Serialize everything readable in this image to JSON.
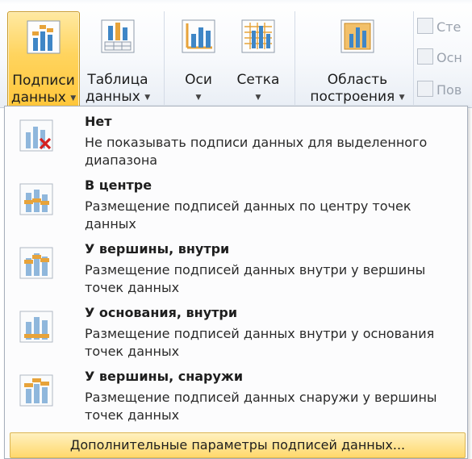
{
  "ribbon": {
    "buttons": [
      {
        "line1": "Подписи",
        "line2": "данных"
      },
      {
        "line1": "Таблица",
        "line2": "данных"
      },
      {
        "line1": "Оси",
        "line2": ""
      },
      {
        "line1": "Сетка",
        "line2": ""
      },
      {
        "line1": "Область",
        "line2": "построения"
      }
    ],
    "small_items": [
      "Сте",
      "Осн",
      "Пов"
    ]
  },
  "menu": {
    "items": [
      {
        "title": "Нет",
        "desc": "Не показывать подписи данных для выделенного диапазона",
        "icon": "no-labels-icon"
      },
      {
        "title": "В центре",
        "desc": "Размещение подписей данных по центру точек данных",
        "icon": "labels-center-icon"
      },
      {
        "title": "У вершины, внутри",
        "desc": "Размещение подписей данных внутри у вершины точек данных",
        "icon": "labels-inside-end-icon"
      },
      {
        "title": "У основания, внутри",
        "desc": "Размещение подписей данных внутри у основания точек данных",
        "icon": "labels-inside-base-icon"
      },
      {
        "title": "У вершины, снаружи",
        "desc": "Размещение подписей данных снаружи у вершины точек данных",
        "icon": "labels-outside-end-icon"
      }
    ],
    "footer": "Дополнительные параметры подписей данных..."
  },
  "colors": {
    "accent": "#ffd45e",
    "menu_border": "#a7afbc",
    "delete_x": "#d42020"
  }
}
